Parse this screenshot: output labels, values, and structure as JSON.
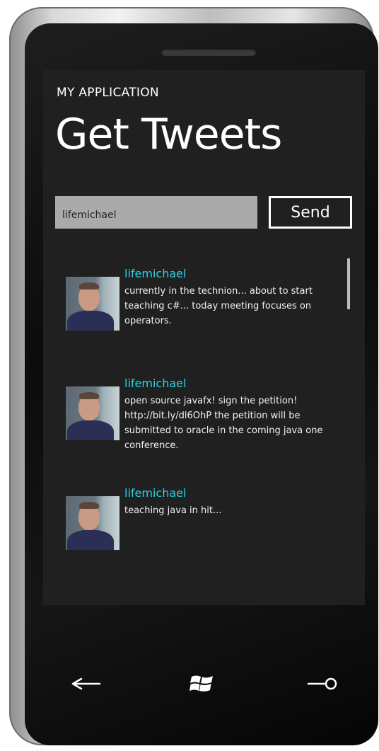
{
  "app": {
    "title": "MY APPLICATION",
    "page_title": "Get Tweets"
  },
  "search": {
    "value": "lifemichael",
    "button_label": "Send"
  },
  "tweets": [
    {
      "user": "lifemichael",
      "text": "currently in the technion... about to start teaching c#... today meeting focuses on operators."
    },
    {
      "user": "lifemichael",
      "text": "open source javafx! sign the petition! http://bit.ly/dl6OhP the petition will be submitted to oracle in the coming java one conference."
    },
    {
      "user": "lifemichael",
      "text": "teaching java in hit..."
    }
  ],
  "hardware_buttons": {
    "back": "back-arrow-icon",
    "start": "windows-logo-icon",
    "search": "search-icon"
  },
  "colors": {
    "screen_background": "#202020",
    "accent_username": "#2ad3e3",
    "input_background": "#aaaaaa"
  }
}
